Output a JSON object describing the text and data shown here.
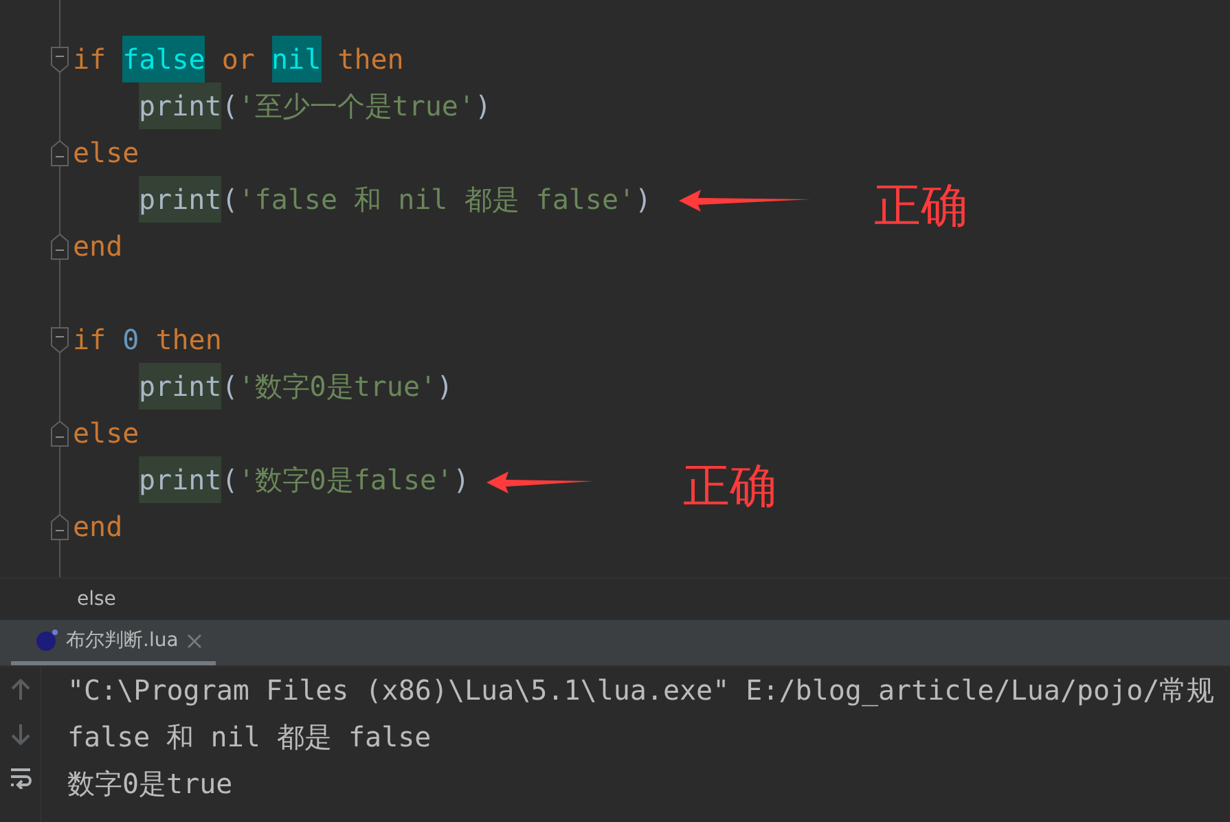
{
  "editor": {
    "lines": [
      {
        "kind": "block-start",
        "tokens": [
          {
            "text": "if ",
            "kind": "keyword"
          },
          {
            "text": "false",
            "kind": "match"
          },
          {
            "text": " or ",
            "kind": "keyword"
          },
          {
            "text": "nil",
            "kind": "match"
          },
          {
            "text": " then",
            "kind": "keyword"
          }
        ],
        "children": [
          {
            "kind": "code",
            "tokens": [
              {
                "text": "print",
                "kind": "usage"
              },
              {
                "text": "(",
                "kind": "plain"
              },
              {
                "text": "'至少一个是true'",
                "kind": "string"
              },
              {
                "text": ")",
                "kind": "plain"
              }
            ]
          }
        ]
      },
      {
        "kind": "block-end",
        "tokens": [
          {
            "text": "else",
            "kind": "keyword"
          }
        ],
        "children": [
          {
            "kind": "code",
            "tokens": [
              {
                "text": "print",
                "kind": "usage"
              },
              {
                "text": "(",
                "kind": "plain"
              },
              {
                "text": "'false 和 nil 都是 false'",
                "kind": "string"
              },
              {
                "text": ")",
                "kind": "plain"
              }
            ]
          }
        ]
      },
      {
        "kind": "block-end",
        "tokens": [
          {
            "text": "end",
            "kind": "keyword"
          }
        ]
      },
      {
        "kind": "blank"
      },
      {
        "kind": "block-start",
        "tokens": [
          {
            "text": "if ",
            "kind": "keyword"
          },
          {
            "text": "0",
            "kind": "number"
          },
          {
            "text": " then",
            "kind": "keyword"
          }
        ],
        "children": [
          {
            "kind": "code",
            "tokens": [
              {
                "text": "print",
                "kind": "usage"
              },
              {
                "text": "(",
                "kind": "plain"
              },
              {
                "text": "'数字0是true'",
                "kind": "string"
              },
              {
                "text": ")",
                "kind": "plain"
              }
            ]
          }
        ]
      },
      {
        "kind": "block-end",
        "tokens": [
          {
            "text": "else",
            "kind": "keyword"
          }
        ],
        "children": [
          {
            "kind": "code",
            "tokens": [
              {
                "text": "print",
                "kind": "usage"
              },
              {
                "text": "(",
                "kind": "plain"
              },
              {
                "text": "'数字0是false'",
                "kind": "string"
              },
              {
                "text": ")",
                "kind": "plain"
              }
            ]
          }
        ]
      },
      {
        "kind": "block-end",
        "tokens": [
          {
            "text": "end",
            "kind": "keyword"
          }
        ]
      }
    ],
    "annotations": [
      {
        "text": "正确"
      },
      {
        "text": "正确"
      }
    ]
  },
  "breadcrumb": {
    "text": "else"
  },
  "run_panel": {
    "tabs": [
      {
        "label": "布尔判断.lua",
        "selected": true
      }
    ],
    "console_lines": [
      {
        "text": "\"C:\\Program Files (x86)\\Lua\\5.1\\lua.exe\" E:/blog_article/Lua/pojo/常规"
      },
      {
        "text": "false 和 nil 都是 false"
      },
      {
        "text": "数字0是true"
      }
    ]
  }
}
